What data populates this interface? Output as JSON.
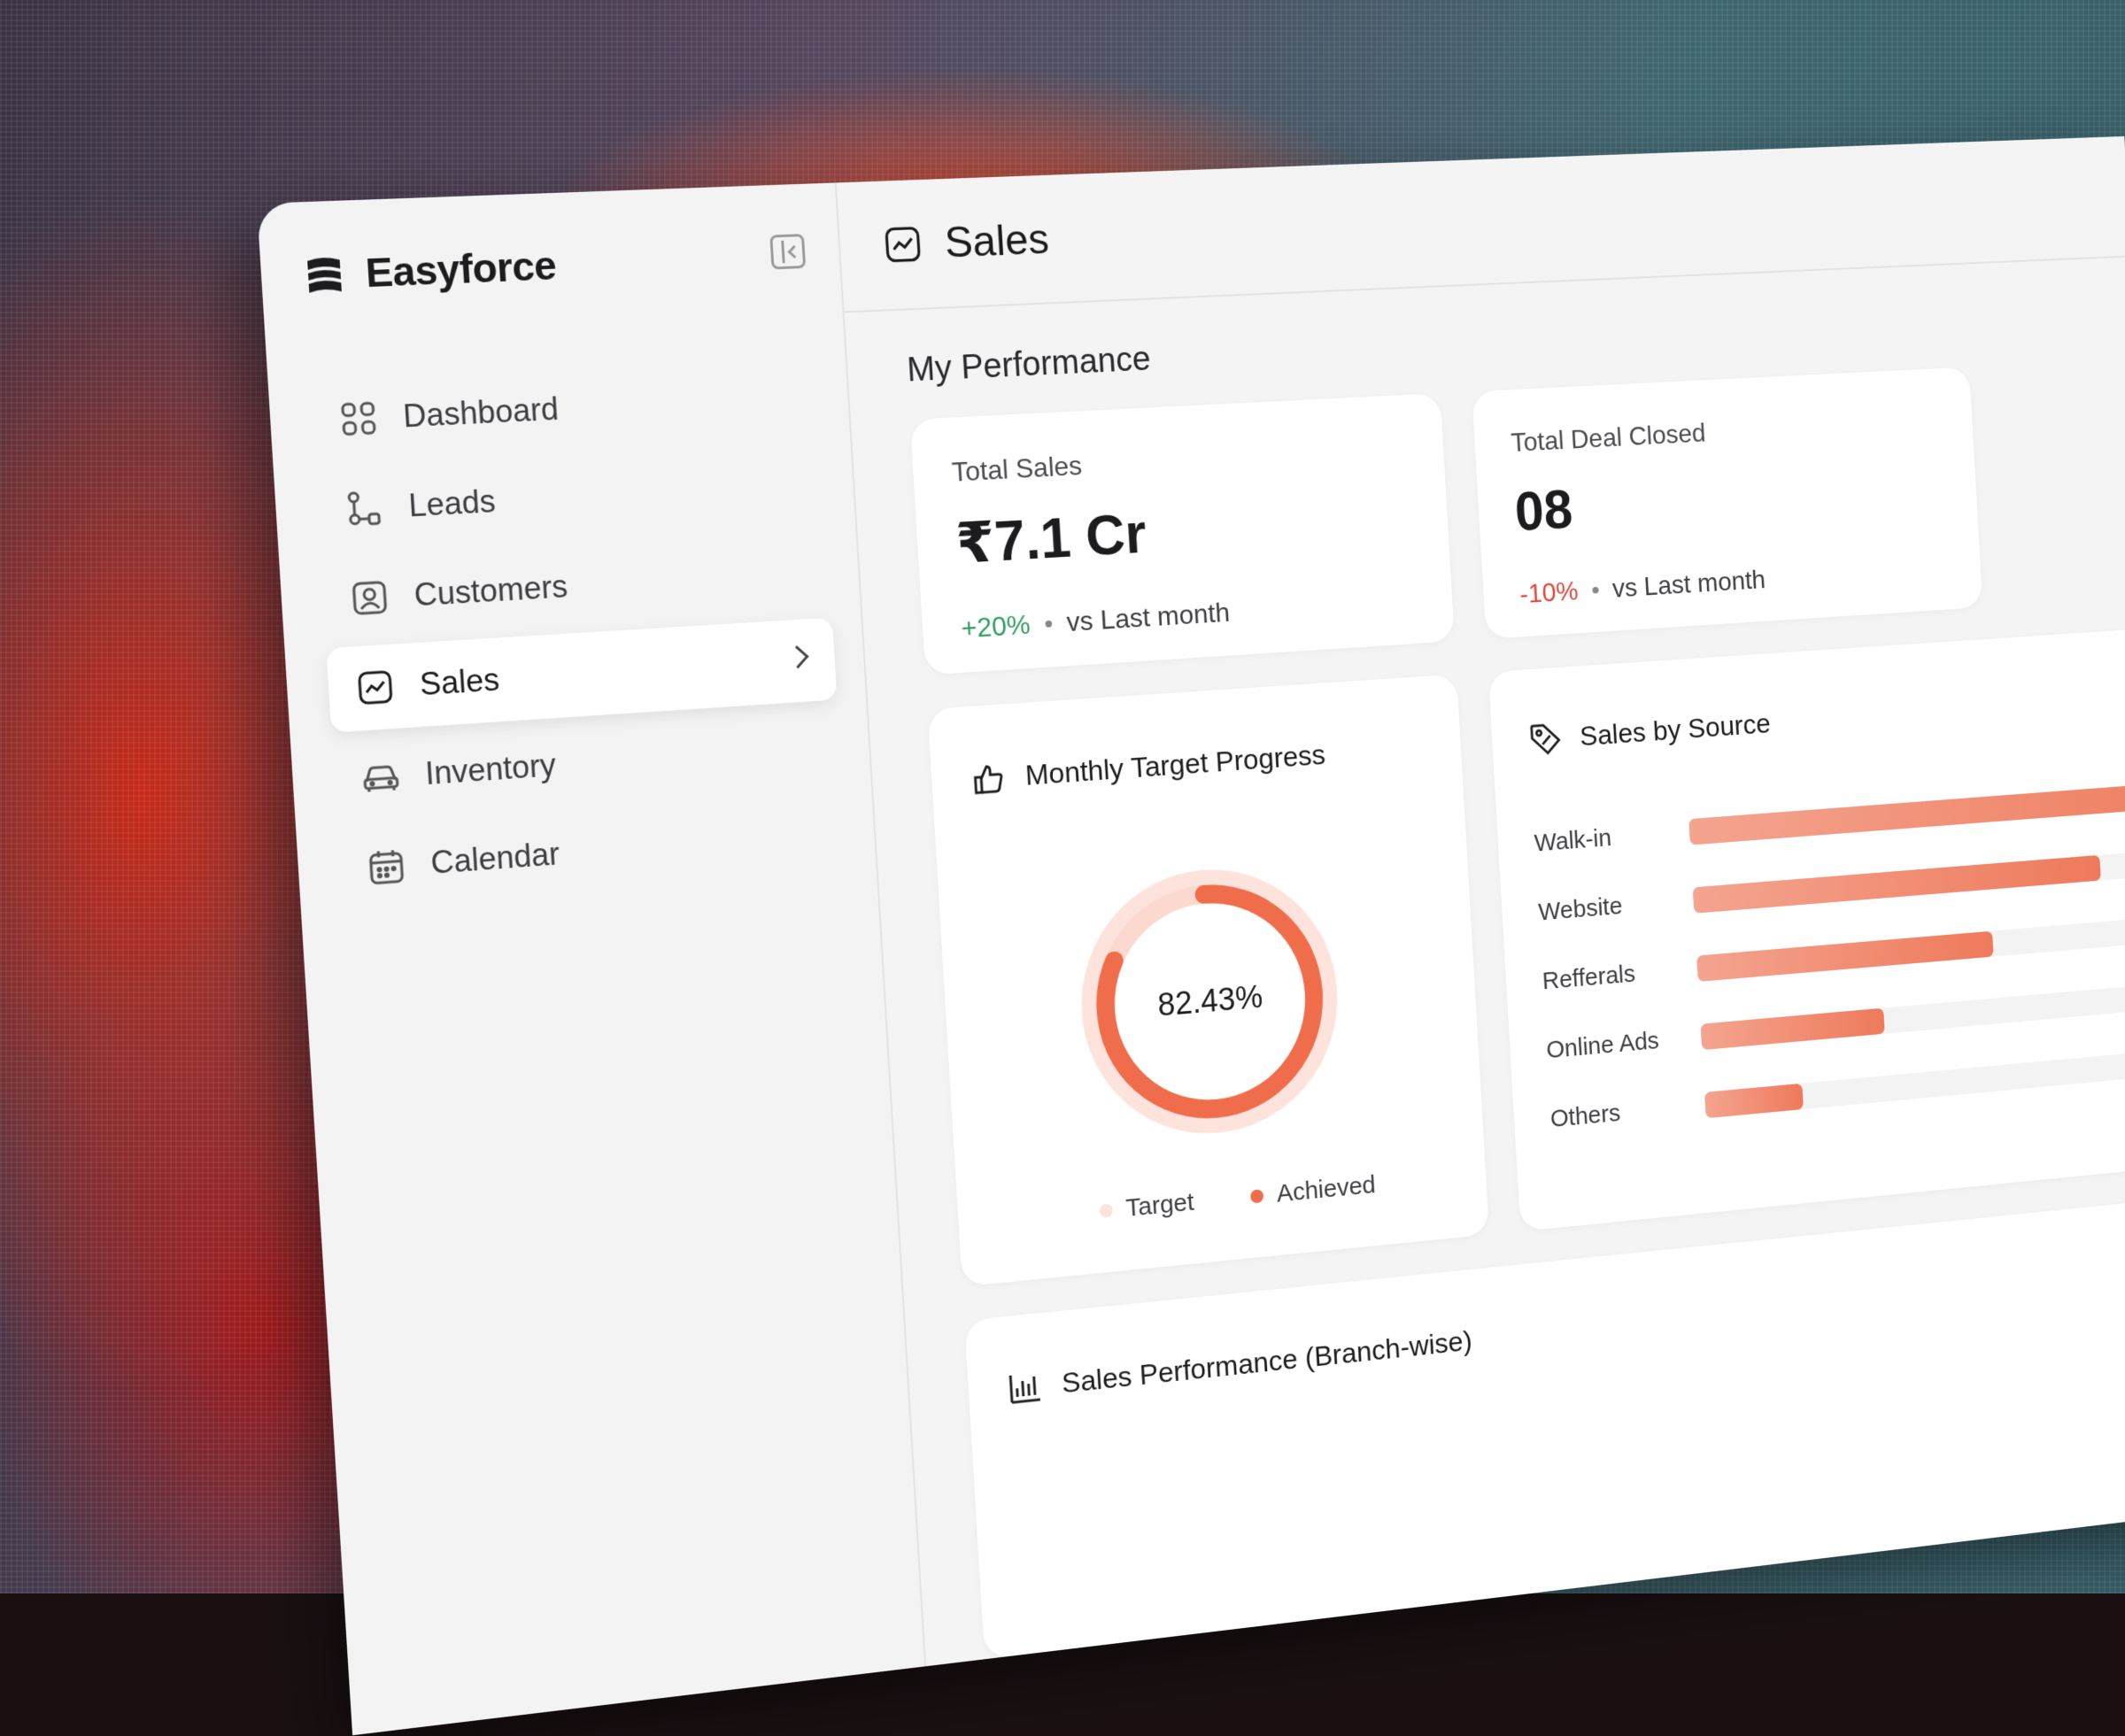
{
  "brand": {
    "name": "Easyforce"
  },
  "sidebar": {
    "items": [
      {
        "label": "Dashboard",
        "icon": "grid-icon",
        "active": false
      },
      {
        "label": "Leads",
        "icon": "flow-icon",
        "active": false
      },
      {
        "label": "Customers",
        "icon": "user-card-icon",
        "active": false
      },
      {
        "label": "Sales",
        "icon": "trend-icon",
        "active": true
      },
      {
        "label": "Inventory",
        "icon": "car-icon",
        "active": false
      },
      {
        "label": "Calendar",
        "icon": "calendar-icon",
        "active": false
      }
    ]
  },
  "header": {
    "title": "Sales",
    "icon": "trend-icon"
  },
  "performance": {
    "title": "My Performance",
    "total_sales": {
      "label": "Total Sales",
      "value": "₹7.1 Cr",
      "delta": "+20%",
      "delta_note": "vs Last month"
    },
    "total_deals": {
      "label": "Total Deal Closed",
      "value": "08",
      "delta": "-10%",
      "delta_note": "vs Last month"
    }
  },
  "target_progress": {
    "title": "Monthly Target Progress",
    "percent_text": "82.43%",
    "percent": 82.43,
    "legend": {
      "target": "Target",
      "achieved": "Achieved"
    },
    "colors": {
      "target": "#fde3dc",
      "achieved": "#ef6d4b"
    }
  },
  "sales_by_source": {
    "title": "Sales by Source",
    "items": [
      {
        "label": "Walk-in",
        "value": 100
      },
      {
        "label": "Website",
        "value": 72
      },
      {
        "label": "Refferals",
        "value": 52
      },
      {
        "label": "Online Ads",
        "value": 32
      },
      {
        "label": "Others",
        "value": 17
      }
    ]
  },
  "branch_perf": {
    "title": "Sales Performance (Branch-wise)"
  }
}
